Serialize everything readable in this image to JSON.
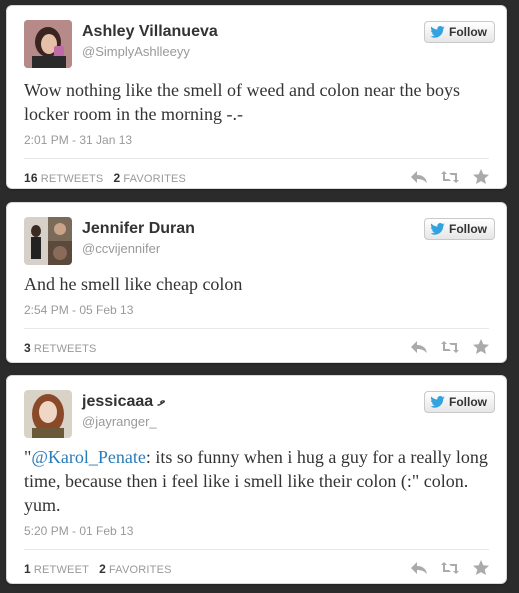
{
  "colors": {
    "background": "#2b2b2b",
    "card": "#ffffff",
    "mention": "#2b7bb9",
    "bird": "#33a3e0",
    "action_icon": "#aaaaaa"
  },
  "follow_label": "Follow",
  "tweets": [
    {
      "name": "Ashley Villanueva",
      "handle": "@SimplyAshlleeyy",
      "text": "Wow nothing like the smell of weed and colon near the boys locker room in the morning -.-",
      "timestamp": "2:01 PM - 31 Jan 13",
      "stats": [
        {
          "count": "16",
          "label": "RETWEETS"
        },
        {
          "count": "2",
          "label": "FAVORITES"
        }
      ]
    },
    {
      "name": "Jennifer Duran",
      "handle": "@ccvijennifer",
      "text": "And he smell like cheap colon",
      "timestamp": "2:54 PM - 05 Feb 13",
      "stats": [
        {
          "count": "3",
          "label": "RETWEETS"
        }
      ]
    },
    {
      "name": "jessicaaa ވ",
      "handle": "@jayranger_",
      "text_prefix": "\"",
      "mention": "@Karol_Penate",
      "text_rest": ": its so funny when i hug a guy for a really long time, because then i feel like i smell like their colon (:\" colon. yum.",
      "timestamp": "5:20 PM - 01 Feb 13",
      "stats": [
        {
          "count": "1",
          "label": "RETWEET"
        },
        {
          "count": "2",
          "label": "FAVORITES"
        }
      ]
    }
  ]
}
